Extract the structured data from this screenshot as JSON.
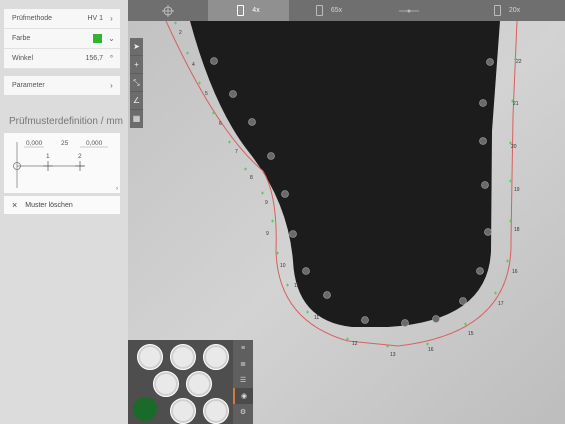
{
  "panel": {
    "method_label": "Prüfmethode",
    "method_value": "HV 1",
    "color_label": "Farbe",
    "color_value": "#31b531",
    "angle_label": "Winkel",
    "angle_value": "156,7",
    "angle_unit": "°",
    "parameter_label": "Parameter",
    "definition_title": "Prüfmusterdefinition / mm",
    "def_val1": "0,000",
    "def_val2": "25",
    "def_val3": "0,000",
    "def_n1": "1",
    "def_n2": "2",
    "delete_label": "Muster löschen"
  },
  "toolbar": {
    "items": [
      {
        "label": "",
        "icon": "crosshair-icon"
      },
      {
        "label": "4x",
        "icon": "objective-icon"
      },
      {
        "label": "65x",
        "icon": "objective-icon"
      },
      {
        "label": "",
        "icon": "line-icon"
      },
      {
        "label": "20x",
        "icon": "objective-icon"
      }
    ]
  },
  "points": [
    "1",
    "2",
    "3",
    "4",
    "5",
    "6",
    "7",
    "8",
    "9",
    "10",
    "11",
    "12",
    "13",
    "14",
    "15",
    "16",
    "17",
    "18",
    "19",
    "20",
    "21",
    "22"
  ]
}
